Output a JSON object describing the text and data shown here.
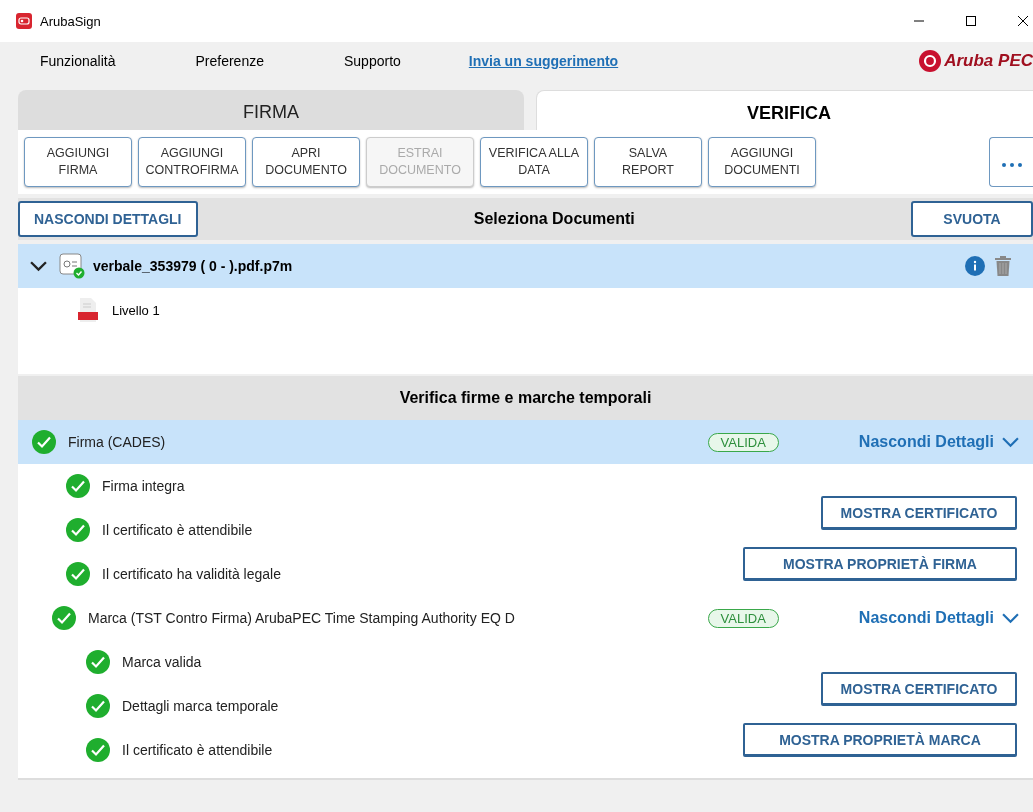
{
  "window": {
    "title": "ArubaSign"
  },
  "menu": [
    {
      "label": "Funzionalità",
      "kind": "menu"
    },
    {
      "label": "Preferenze",
      "kind": "menu"
    },
    {
      "label": "Supporto",
      "kind": "menu"
    },
    {
      "label": "Invia un suggerimento",
      "kind": "link"
    }
  ],
  "logo": {
    "text": "Aruba PEC"
  },
  "tabs": [
    {
      "label": "FIRMA",
      "selected": false
    },
    {
      "label": "VERIFICA",
      "selected": true
    }
  ],
  "toolbar": [
    {
      "label": "AGGIUNGI\nFIRMA",
      "disabled": false
    },
    {
      "label": "AGGIUNGI\nCONTROFIRMA",
      "disabled": false
    },
    {
      "label": "APRI\nDOCUMENTO",
      "disabled": false
    },
    {
      "label": "ESTRAI\nDOCUMENTO",
      "disabled": true
    },
    {
      "label": "VERIFICA ALLA\nDATA",
      "disabled": false
    },
    {
      "label": "SALVA\nREPORT",
      "disabled": false
    },
    {
      "label": "AGGIUNGI\nDOCUMENTI",
      "disabled": false
    }
  ],
  "documents": {
    "toggle_button": "NASCONDI DETTAGLI",
    "title": "Seleziona Documenti",
    "clear_button": "SVUOTA",
    "files": [
      {
        "name": "verbale_353979 ( 0 - ).pdf.p7m",
        "expanded": true,
        "selected": true,
        "children": [
          {
            "name": "Livello 1"
          }
        ]
      }
    ]
  },
  "verification": {
    "title": "Verifica firme e marche temporali",
    "items": [
      {
        "label": "Firma (CADES)",
        "status": "VALIDA",
        "toggle": "Nascondi Dettagli",
        "selected": true,
        "expanded": true,
        "checks": [
          {
            "label": "Firma integra"
          },
          {
            "label": "Il certificato è attendibile",
            "action": "MOSTRA CERTIFICATO"
          },
          {
            "label": "Il certificato ha validità legale",
            "action": "MOSTRA PROPRIETÀ FIRMA"
          }
        ],
        "children": [
          {
            "label": "Marca (TST Contro Firma) ArubaPEC Time Stamping Authority EQ D",
            "status": "VALIDA",
            "toggle": "Nascondi Dettagli",
            "selected": false,
            "expanded": true,
            "checks": [
              {
                "label": "Marca valida"
              },
              {
                "label": "Dettagli marca temporale",
                "action": "MOSTRA CERTIFICATO"
              },
              {
                "label": "Il certificato è attendibile",
                "action": "MOSTRA PROPRIETÀ MARCA"
              }
            ]
          }
        ]
      }
    ]
  }
}
